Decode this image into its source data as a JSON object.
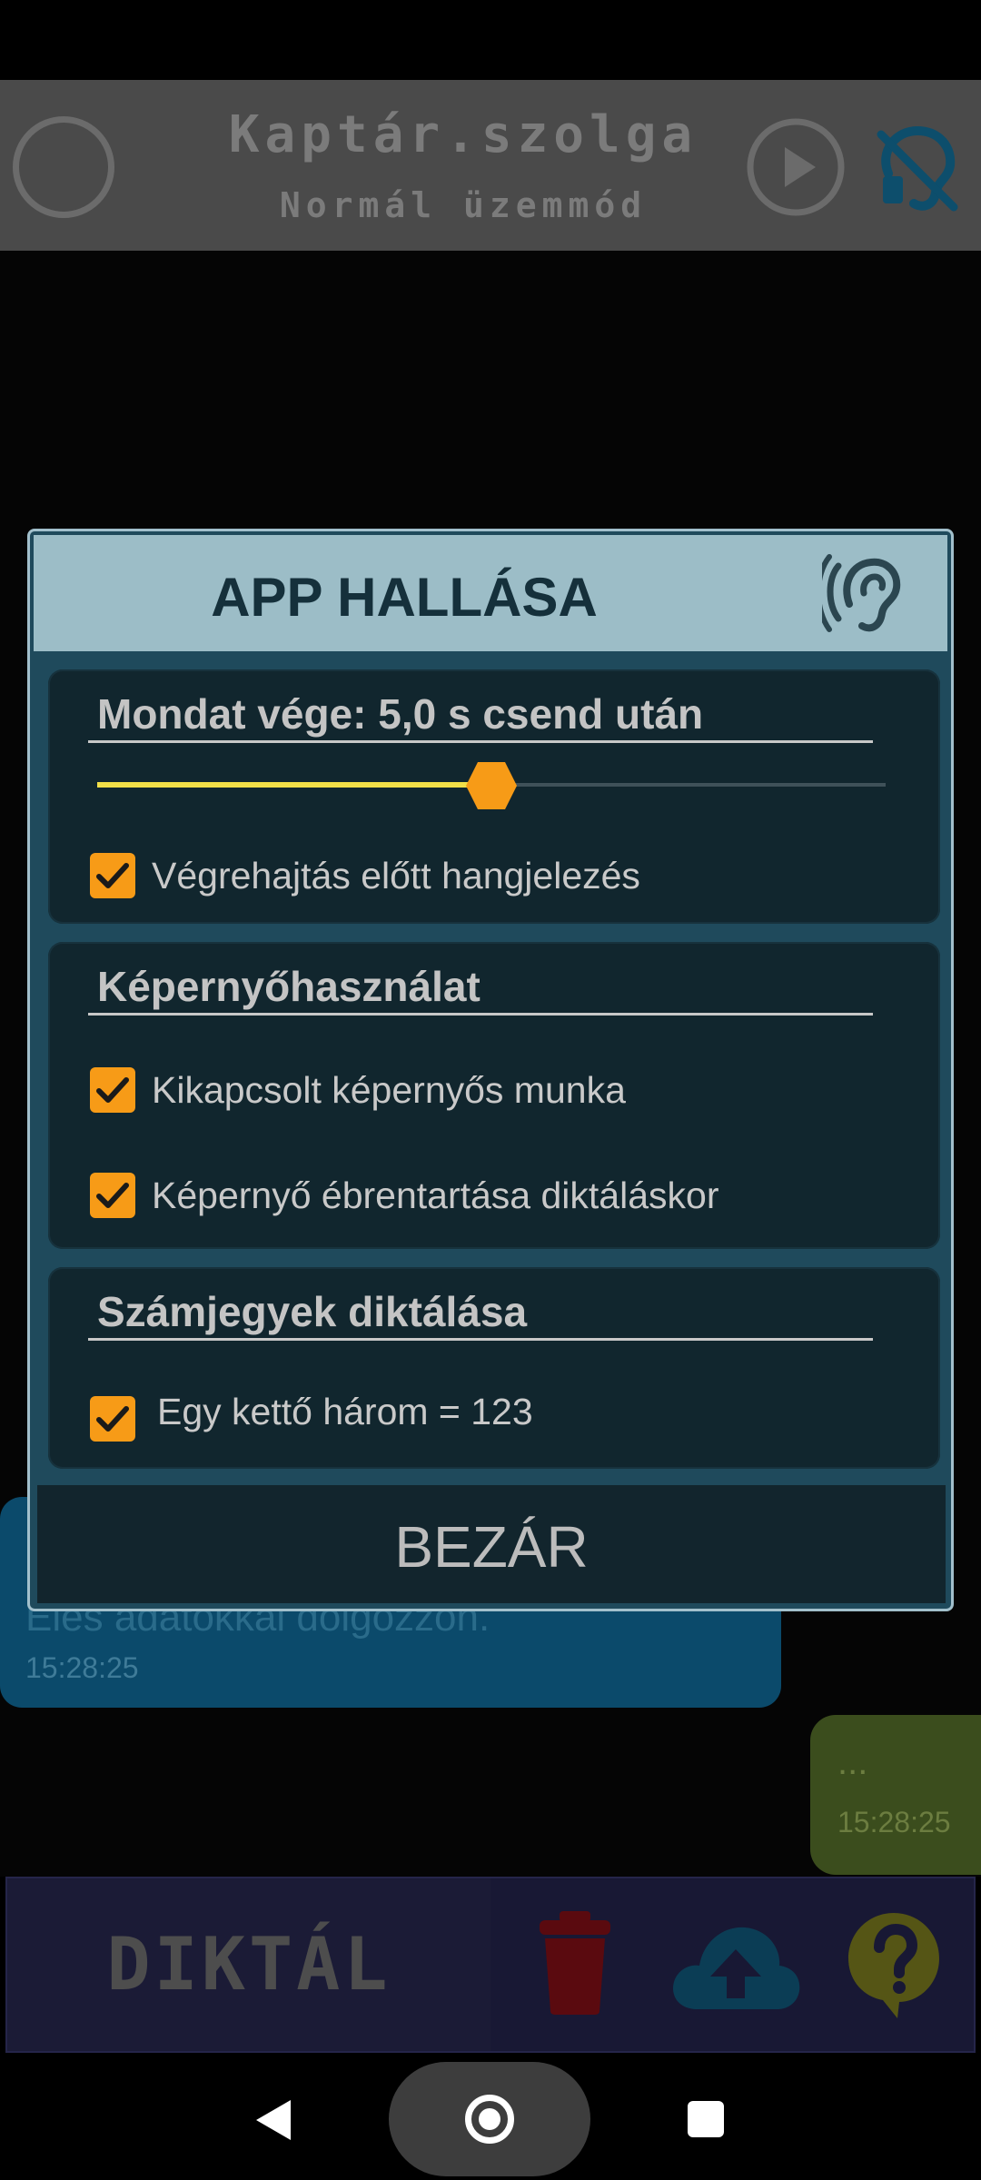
{
  "header": {
    "title": "Kaptár.szolga",
    "subtitle": "Normál üzemmód"
  },
  "chat": {
    "bubble_text": "Éles adatokkal dolgozzon.",
    "bubble_time": "15:28:25",
    "reply_text": "...",
    "reply_time": "15:28:25"
  },
  "toolbar": {
    "dictate_label": "DIKTÁL"
  },
  "dialog": {
    "title": "APP HALLÁSA",
    "sections": [
      {
        "title": "Mondat vége: 5,0 s csend után",
        "slider": {
          "value": 5.0,
          "fraction": 0.5
        },
        "checkboxes": [
          {
            "label": "Végrehajtás előtt hangjelezés",
            "checked": true
          }
        ]
      },
      {
        "title": "Képernyőhasználat",
        "checkboxes": [
          {
            "label": "Kikapcsolt képernyős munka",
            "checked": true
          },
          {
            "label": "Képernyő ébrentartása diktáláskor",
            "checked": true
          }
        ]
      },
      {
        "title": "Számjegyek diktálása",
        "checkboxes": [
          {
            "label": "Egy kettő három = 123",
            "checked": true
          }
        ]
      }
    ],
    "close_label": "BEZÁR"
  },
  "icons": {
    "header_left": "circle-icon",
    "header_play": "play-icon",
    "header_right": "ear-muted-icon",
    "dialog_ear": "ear-icon",
    "trash": "trash-icon",
    "upload": "cloud-upload-icon",
    "help": "help-bubble-icon"
  },
  "colors": {
    "accent_orange": "#f79b17",
    "slider_fill": "#f2df48",
    "dialog_header": "#9cbdc7",
    "dialog_border": "#a2c0cc"
  }
}
